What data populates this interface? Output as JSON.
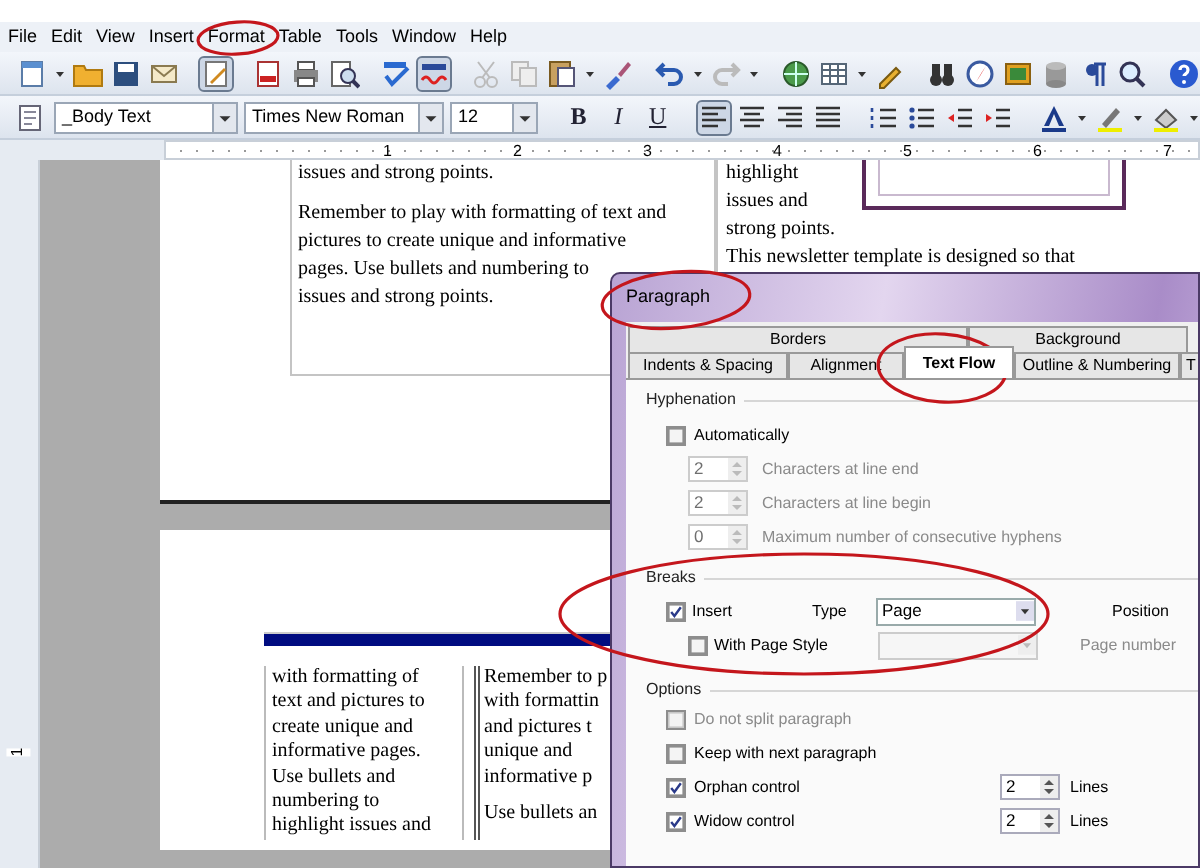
{
  "menu": [
    "File",
    "Edit",
    "View",
    "Insert",
    "Format",
    "Table",
    "Tools",
    "Window",
    "Help"
  ],
  "standard_toolbar": {
    "edit_mode_on": true,
    "auto_spellcheck_on": true
  },
  "formatting_toolbar": {
    "paragraph_style": "_Body Text",
    "font_name": "Times New Roman",
    "font_size": "12",
    "style_buttons": [
      {
        "label": "B",
        "kind": "bold"
      },
      {
        "label": "I",
        "kind": "italic"
      },
      {
        "label": "U",
        "kind": "underline"
      }
    ],
    "alignment_buttons": [
      {
        "selected": true
      },
      {
        "selected": false
      },
      {
        "selected": false
      },
      {
        "selected": false
      }
    ]
  },
  "ruler": {
    "labels": [
      "1",
      "2",
      "3",
      "4",
      "5",
      "6",
      "7"
    ]
  },
  "vertical_ruler": {
    "labels": [
      "1"
    ]
  },
  "document": {
    "page_1": {
      "column_1": {
        "paragraphs": [
          [
            "issues and strong points."
          ],
          [
            "Remember to play with formatting of text and",
            "pictures to create unique and informative",
            "pages. Use bullets and numbering to",
            "issues and strong points."
          ]
        ]
      },
      "column_2": {
        "lines": [
          "highlight",
          "issues and",
          "strong points.",
          "This newsletter template is designed so that"
        ]
      }
    },
    "page_2": {
      "column_1": {
        "lines": [
          "with formatting of",
          "text and pictures to",
          "create unique and",
          "informative pages.",
          "Use bullets and",
          "numbering to",
          "highlight issues and"
        ]
      },
      "column_2": {
        "paragraphs": [
          [
            "Remember to p",
            "with formattin",
            "and pictures t",
            "unique and",
            "informative p"
          ],
          [
            "Use bullets an"
          ]
        ]
      }
    }
  },
  "dialog": {
    "title": "Paragraph",
    "tab_rows": [
      [
        {
          "label": "Borders",
          "selected": false
        },
        {
          "label": "Background",
          "selected": false
        }
      ],
      [
        {
          "label": "Indents & Spacing",
          "selected": false
        },
        {
          "label": "Alignment",
          "selected": false
        },
        {
          "label": "Text Flow",
          "selected": true
        },
        {
          "label": "Outline & Numbering",
          "selected": false
        },
        {
          "label": "T",
          "selected": false
        }
      ]
    ],
    "hyphenation": {
      "title": "Hyphenation",
      "automatic": {
        "label": "Automatically",
        "checked": false
      },
      "fields": [
        {
          "value": "2",
          "label": "Characters at line end",
          "disabled": true
        },
        {
          "value": "2",
          "label": "Characters at line begin",
          "disabled": true
        },
        {
          "value": "0",
          "label": "Maximum number of consecutive hyphens",
          "disabled": true
        }
      ]
    },
    "breaks": {
      "title": "Breaks",
      "insert": {
        "label": "Insert",
        "checked": true
      },
      "type_label": "Type",
      "type_select": {
        "value": "Page"
      },
      "position_label": "Position",
      "with_page_style": {
        "label": "With Page Style",
        "checked": false
      },
      "page_style_select": {
        "disabled": true
      },
      "page_number_label": {
        "label": "Page number",
        "disabled": true
      }
    },
    "options": {
      "title": "Options",
      "items": [
        {
          "label": "Do not split paragraph",
          "checked": false,
          "disabled": true
        },
        {
          "label": "Keep with next paragraph",
          "checked": false,
          "disabled": false
        },
        {
          "label": "Orphan control",
          "checked": true,
          "disabled": false,
          "value": "2",
          "unit": "Lines"
        },
        {
          "label": "Widow control",
          "checked": true,
          "disabled": false,
          "value": "2",
          "unit": "Lines"
        }
      ]
    }
  }
}
